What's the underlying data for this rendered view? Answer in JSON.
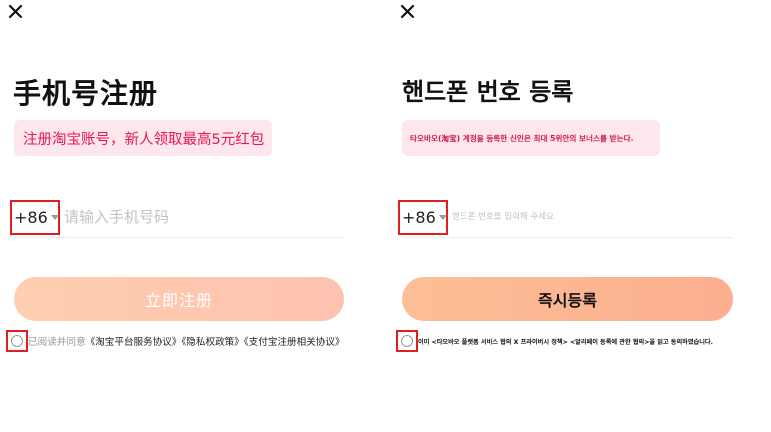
{
  "left": {
    "title": "手机号注册",
    "promo": "注册淘宝账号，新人领取最高5元红包",
    "country_code": "+86",
    "phone_placeholder": "请输入手机号码",
    "submit_label": "立即注册",
    "agree_prefix": "已阅读并同意",
    "agree_links": [
      "《淘宝平台服务协议》",
      "《隐私权政策》",
      "《支付宝注册相关协议》"
    ]
  },
  "right": {
    "title": "핸드폰 번호 등록",
    "promo": "타오바오(淘宝) 계정을 등록한 신인은 최대 5위안의 보너스를 받는다.",
    "country_code": "+86",
    "phone_placeholder": "핸드폰 번호를 입력해 주세요",
    "submit_label": "즉시등록",
    "agree_prefix": "이미 ",
    "agree_link_1": "<타오바오 플랫폼 서비스 협의 X 프라이버시 정책>",
    "agree_link_2": "<알리페이 등록에 관한 협의>",
    "agree_suffix": "을 읽고 동의하였습니다."
  },
  "colors": {
    "accent_red": "#e02020",
    "promo_bg": "#fde7ec",
    "promo_text": "#e8174e",
    "button_gradient_start": "#fec7a2",
    "button_gradient_end": "#feb7a2"
  },
  "icons": {
    "close": "close-icon",
    "caret": "chevron-down-icon",
    "radio": "radio-icon"
  }
}
